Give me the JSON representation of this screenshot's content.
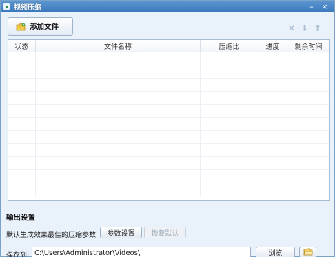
{
  "window": {
    "title": "视频压缩",
    "controls": [
      "minimize-icon",
      "close-icon"
    ]
  },
  "toolbar": {
    "add_file_label": "添加文件",
    "list_tools": [
      "remove-icon",
      "move-down-icon",
      "move-up-icon"
    ]
  },
  "table": {
    "columns": [
      "状态",
      "文件名称",
      "压缩比",
      "进度",
      "剩余时间"
    ],
    "rows": []
  },
  "output": {
    "heading": "输出设置",
    "default_text": "默认生成效果最佳的压缩参数",
    "params_button": "参数设置",
    "restore_button": "恢复默认",
    "save_label": "保存到:",
    "save_path": "C:\\Users\\Administrator\\Videos\\",
    "browse_button": "浏览"
  },
  "colors": {
    "titlebar": "#3a78bd",
    "background": "#e9f1fa",
    "border": "#a9bccf"
  }
}
